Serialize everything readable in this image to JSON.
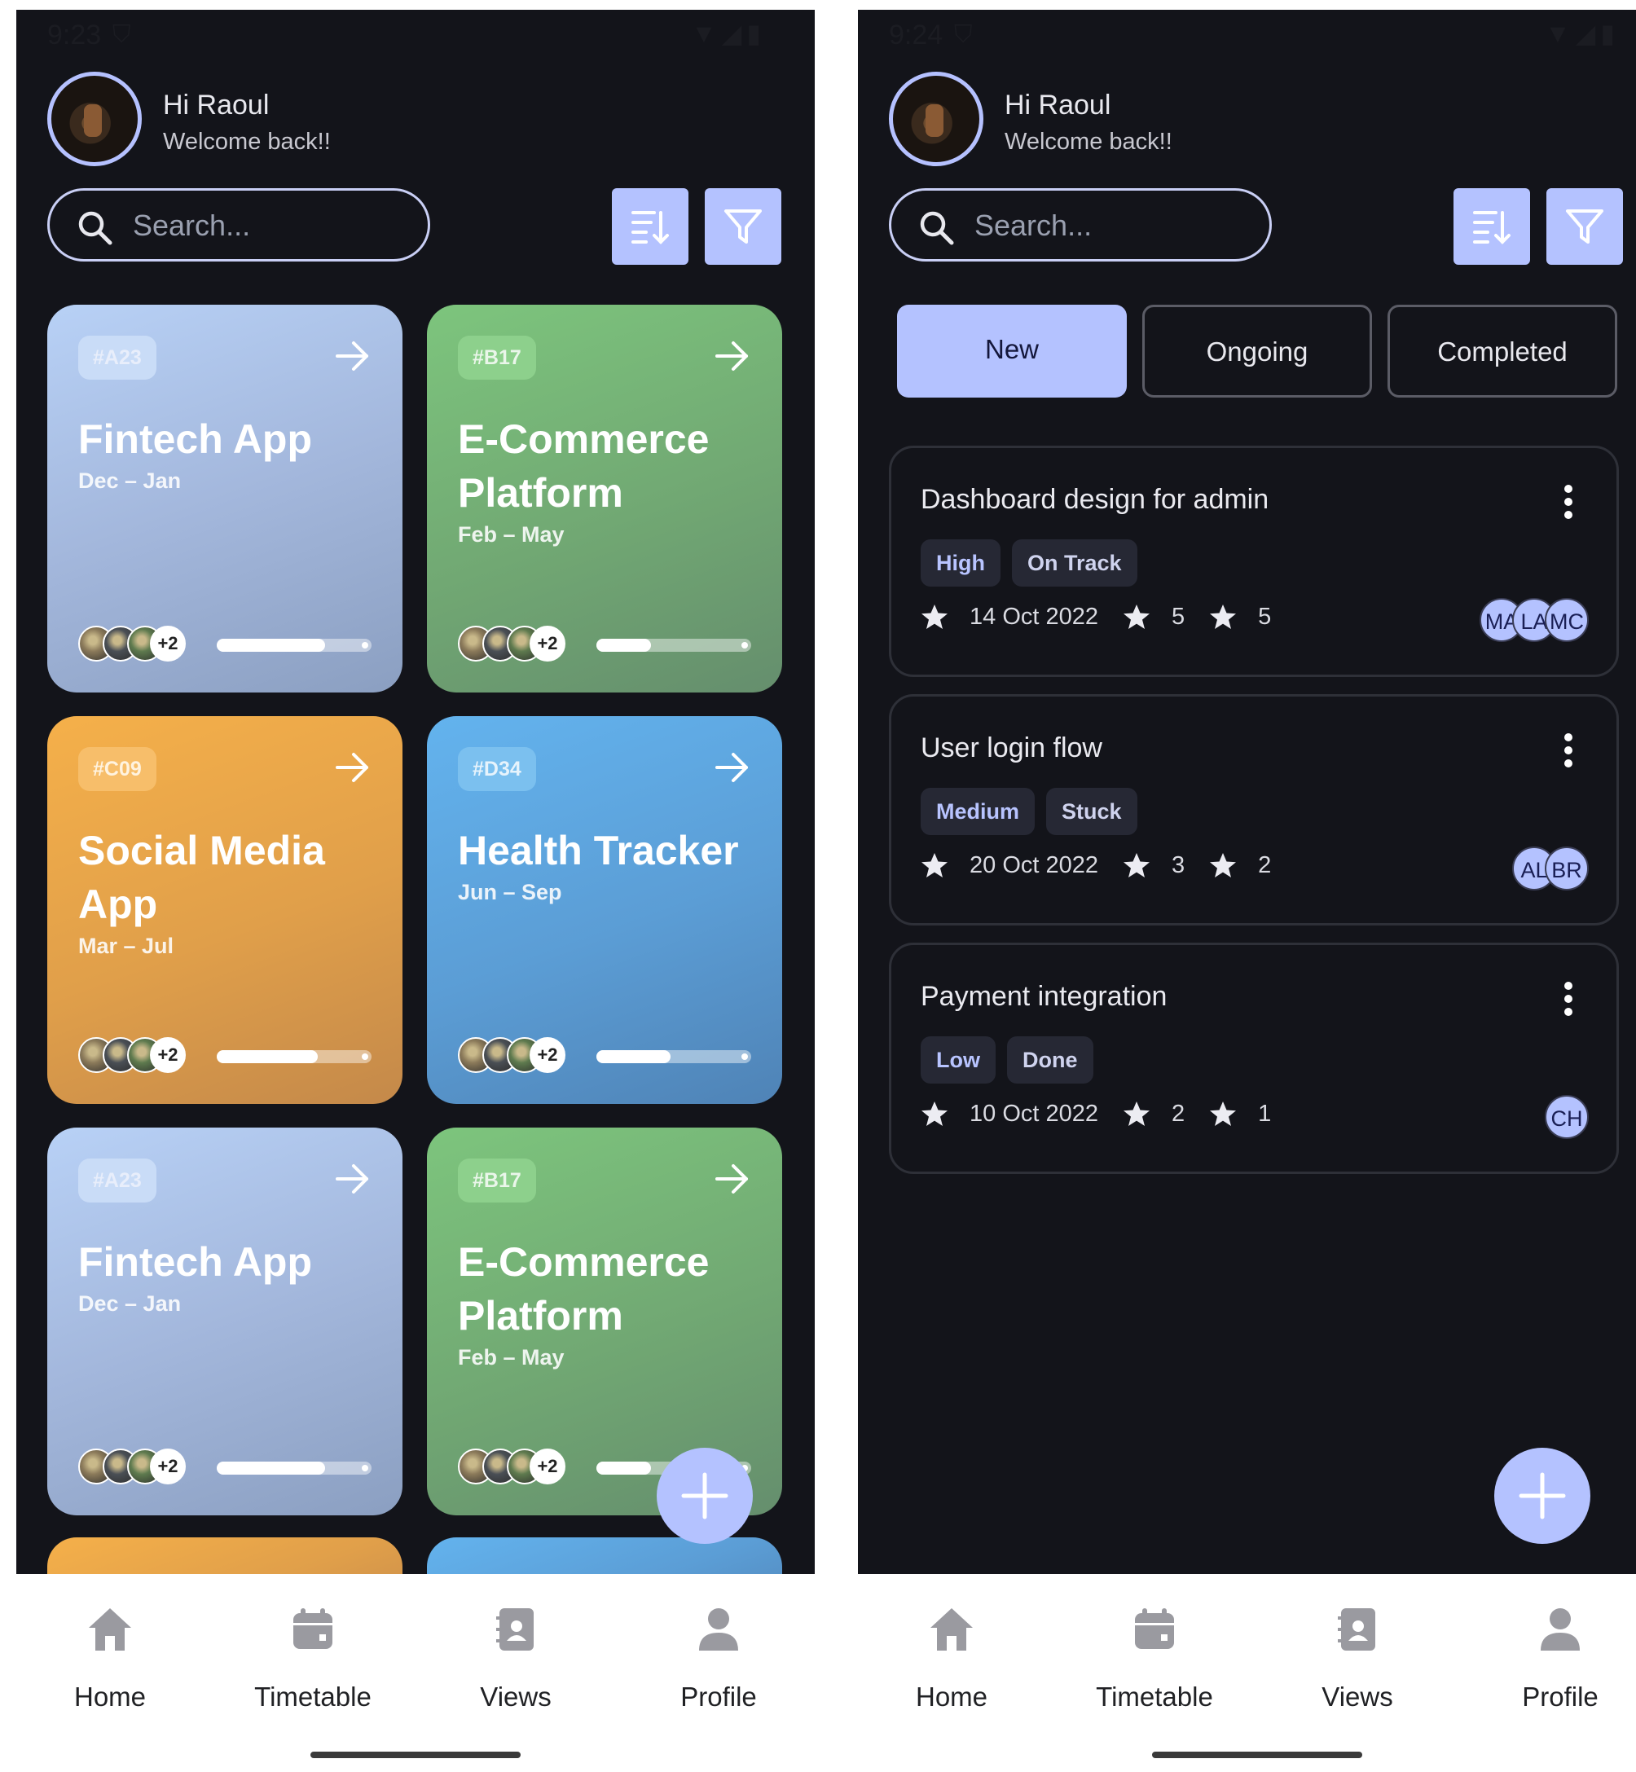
{
  "left": {
    "status": {
      "time": "9:23"
    },
    "header": {
      "greeting": "Hi Raoul",
      "subtitle": "Welcome back!!"
    },
    "search": {
      "placeholder": "Search..."
    },
    "cards": [
      {
        "code": "#A23",
        "title": "Fintech App",
        "dates": "Dec – Jan",
        "more": "+2",
        "progress": 0.7,
        "theme": "blue"
      },
      {
        "code": "#B17",
        "title": "E-Commerce Platform",
        "dates": "Feb – May",
        "more": "+2",
        "progress": 0.35,
        "theme": "green"
      },
      {
        "code": "#C09",
        "title": "Social Media App",
        "dates": "Mar – Jul",
        "more": "+2",
        "progress": 0.65,
        "theme": "orange"
      },
      {
        "code": "#D34",
        "title": "Health Tracker",
        "dates": "Jun – Sep",
        "more": "+2",
        "progress": 0.48,
        "theme": "sky"
      },
      {
        "code": "#A23",
        "title": "Fintech App",
        "dates": "Dec – Jan",
        "more": "+2",
        "progress": 0.7,
        "theme": "blue"
      },
      {
        "code": "#B17",
        "title": "E-Commerce Platform",
        "dates": "Feb – May",
        "more": "+2",
        "progress": 0.35,
        "theme": "green"
      }
    ],
    "nav": [
      {
        "label": "Home",
        "icon": "home-icon"
      },
      {
        "label": "Timetable",
        "icon": "calendar-icon"
      },
      {
        "label": "Views",
        "icon": "contact-book-icon"
      },
      {
        "label": "Profile",
        "icon": "person-icon"
      }
    ]
  },
  "right": {
    "status": {
      "time": "9:24"
    },
    "header": {
      "greeting": "Hi Raoul",
      "subtitle": "Welcome back!!"
    },
    "search": {
      "placeholder": "Search..."
    },
    "tabs": [
      {
        "label": "New",
        "active": true
      },
      {
        "label": "Ongoing",
        "active": false
      },
      {
        "label": "Completed",
        "active": false
      }
    ],
    "tasks": [
      {
        "title": "Dashboard design for admin",
        "priority": "High",
        "status": "On Track",
        "date": "14 Oct 2022",
        "count1": "5",
        "count2": "5",
        "people": [
          "MA",
          "LA",
          "MC"
        ]
      },
      {
        "title": "User login flow",
        "priority": "Medium",
        "status": "Stuck",
        "date": "20 Oct 2022",
        "count1": "3",
        "count2": "2",
        "people": [
          "AL",
          "BR"
        ]
      },
      {
        "title": "Payment integration",
        "priority": "Low",
        "status": "Done",
        "date": "10 Oct 2022",
        "count1": "2",
        "count2": "1",
        "people": [
          "CH"
        ]
      }
    ],
    "nav": [
      {
        "label": "Home",
        "icon": "home-icon"
      },
      {
        "label": "Timetable",
        "icon": "calendar-icon"
      },
      {
        "label": "Views",
        "icon": "contact-book-icon"
      },
      {
        "label": "Profile",
        "icon": "person-icon"
      }
    ]
  },
  "colors": {
    "background": "#13141a",
    "accent": "#b4c2ff",
    "nav_icon": "#9a9aa0"
  }
}
